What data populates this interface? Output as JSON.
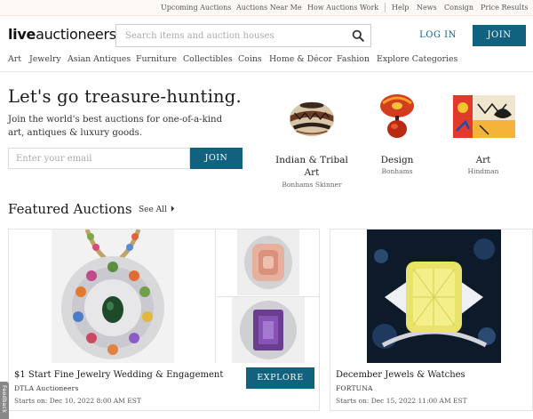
{
  "utility_nav": {
    "items": [
      "Upcoming Auctions",
      "Auctions Near Me",
      "How Auctions Work",
      "Help",
      "News",
      "Consign",
      "Price Results"
    ]
  },
  "header": {
    "logo_bold": "live",
    "logo_rest": "auctioneers",
    "search_placeholder": "Search items and auction houses",
    "search_icon": "search-icon",
    "login_label": "LOG IN",
    "join_label": "JOIN"
  },
  "categories": [
    "Art",
    "Jewelry",
    "Asian Antiques",
    "Furniture",
    "Collectibles",
    "Coins",
    "Home & Décor",
    "Fashion",
    "Explore Categories"
  ],
  "hero": {
    "title": "Let's go treasure-hunting.",
    "subtitle": "Join the world's best auctions for one-of-a-kind art, antiques & luxury goods.",
    "email_placeholder": "Enter your email",
    "join_label": "JOIN",
    "featured_categories": [
      {
        "name": "Indian & Tribal Art",
        "house": "Bonhams Skinner"
      },
      {
        "name": "Design",
        "house": "Bonhams"
      },
      {
        "name": "Art",
        "house": "Hindman"
      }
    ]
  },
  "featured": {
    "title": "Featured Auctions",
    "see_all": "See All",
    "auctions": [
      {
        "title": "$1 Start Fine Jewelry Wedding & Engagement",
        "house": "DTLA Auctioneers",
        "starts": "Starts on: Dec 10, 2022 8:00 AM EST",
        "button": "EXPLORE"
      },
      {
        "title": "December Jewels & Watches",
        "house": "FORTUNA",
        "starts": "Starts on: Dec 15, 2022 11:00 AM EST"
      }
    ]
  },
  "feedback_label": "Feedback",
  "colors": {
    "brand": "#10627e",
    "utility_bar_bg": "#fdf9f6"
  }
}
